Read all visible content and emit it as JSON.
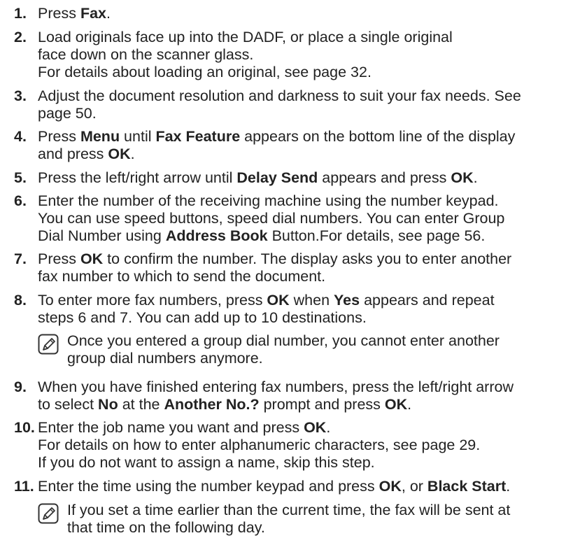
{
  "steps": [
    {
      "num": "1.",
      "lines": [
        [
          {
            "t": "Press "
          },
          {
            "t": "Fax",
            "b": true
          },
          {
            "t": "."
          }
        ]
      ]
    },
    {
      "num": "2.",
      "lines": [
        [
          {
            "t": "Load originals face up into the DADF, or place a single original"
          }
        ],
        [
          {
            "t": "face down on the scanner glass."
          }
        ],
        [
          {
            "t": "For details about loading an original, see page 32."
          }
        ]
      ]
    },
    {
      "num": "3.",
      "lines": [
        [
          {
            "t": "Adjust the document resolution and darkness to suit your fax needs. See"
          }
        ],
        [
          {
            "t": "page 50."
          }
        ]
      ]
    },
    {
      "num": "4.",
      "lines": [
        [
          {
            "t": "Press "
          },
          {
            "t": "Menu",
            "b": true
          },
          {
            "t": " until "
          },
          {
            "t": "Fax Feature",
            "b": true
          },
          {
            "t": " appears on the bottom line of the display"
          }
        ],
        [
          {
            "t": "and press "
          },
          {
            "t": "OK",
            "b": true
          },
          {
            "t": "."
          }
        ]
      ]
    },
    {
      "num": "5.",
      "lines": [
        [
          {
            "t": "Press the left/right arrow until "
          },
          {
            "t": "Delay Send",
            "b": true
          },
          {
            "t": " appears and press "
          },
          {
            "t": "OK",
            "b": true
          },
          {
            "t": "."
          }
        ]
      ]
    },
    {
      "num": "6.",
      "lines": [
        [
          {
            "t": "Enter the number of the receiving machine using the number keypad."
          }
        ],
        [
          {
            "t": "You can use speed buttons, speed dial numbers. You can enter Group"
          }
        ],
        [
          {
            "t": "Dial Number using "
          },
          {
            "t": "Address Book",
            "b": true
          },
          {
            "t": " Button.For details, see page 56."
          }
        ]
      ]
    },
    {
      "num": "7.",
      "lines": [
        [
          {
            "t": "Press "
          },
          {
            "t": "OK",
            "b": true
          },
          {
            "t": " to confirm the number. The display asks you to enter another"
          }
        ],
        [
          {
            "t": "fax number to which to send the document."
          }
        ]
      ]
    },
    {
      "num": "8.",
      "lines": [
        [
          {
            "t": "To enter more fax numbers, press "
          },
          {
            "t": "OK",
            "b": true
          },
          {
            "t": " when "
          },
          {
            "t": "Yes",
            "b": true
          },
          {
            "t": " appears and repeat"
          }
        ],
        [
          {
            "t": "steps 6 and 7. You can add up to 10 destinations."
          }
        ]
      ]
    },
    {
      "num": "9.",
      "lines": [
        [
          {
            "t": "When you have finished entering fax numbers, press the left/right arrow"
          }
        ],
        [
          {
            "t": "to select "
          },
          {
            "t": "No",
            "b": true
          },
          {
            "t": " at the "
          },
          {
            "t": "Another No.?",
            "b": true
          },
          {
            "t": " prompt and press "
          },
          {
            "t": "OK",
            "b": true
          },
          {
            "t": "."
          }
        ]
      ]
    },
    {
      "num": "10.",
      "lines": [
        [
          {
            "t": "Enter the job name you want and press "
          },
          {
            "t": "OK",
            "b": true
          },
          {
            "t": "."
          }
        ],
        [
          {
            "t": "For details on how to enter alphanumeric characters, see page 29."
          }
        ],
        [
          {
            "t": "If you do not want to assign a name, skip this step."
          }
        ]
      ]
    },
    {
      "num": "11.",
      "lines": [
        [
          {
            "t": "Enter the time using the number keypad and press "
          },
          {
            "t": "OK",
            "b": true
          },
          {
            "t": ", or "
          },
          {
            "t": "Black Start",
            "b": true
          },
          {
            "t": "."
          }
        ]
      ]
    }
  ],
  "notes": [
    {
      "lines": [
        "Once you entered a group dial number, you cannot enter another",
        "group dial numbers anymore."
      ]
    },
    {
      "lines": [
        "If you set a time earlier than the current time, the fax will be sent at",
        "that time on the following day."
      ]
    }
  ]
}
